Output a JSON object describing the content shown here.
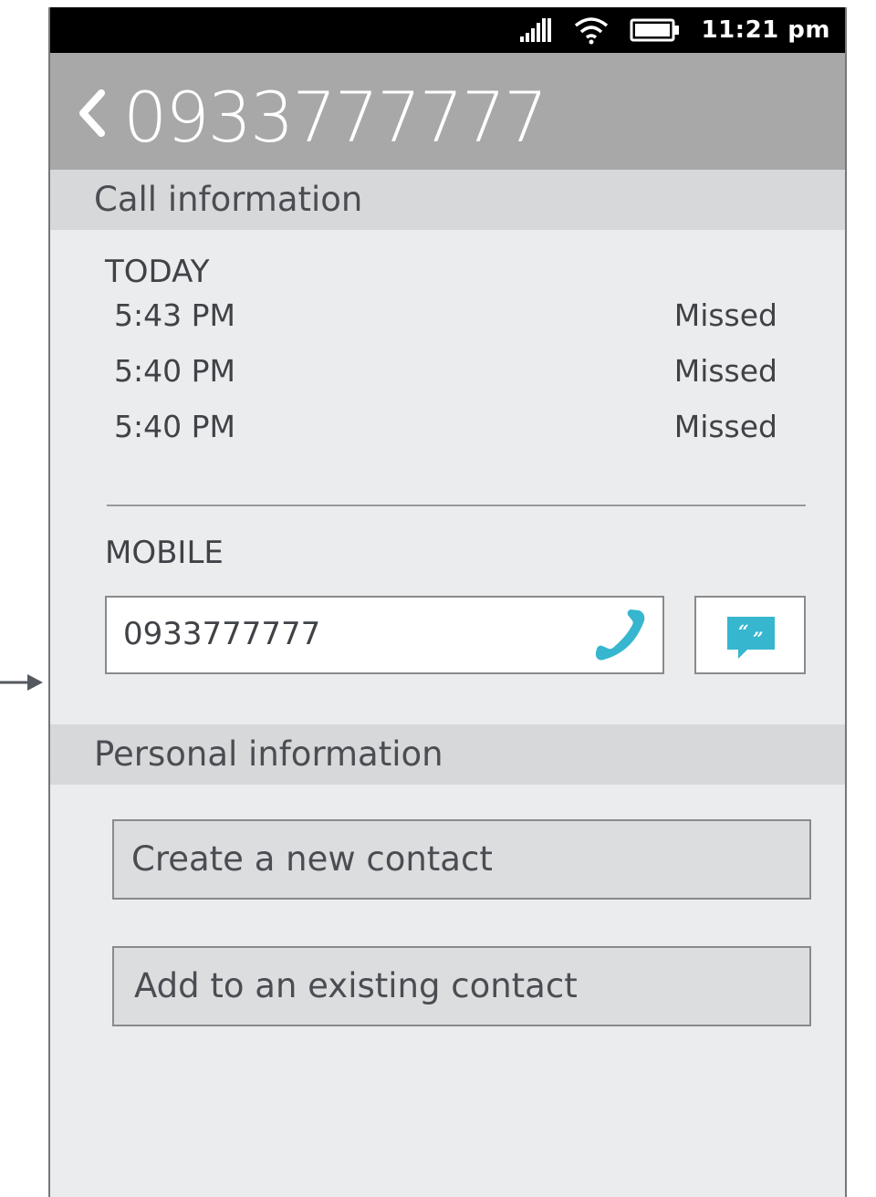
{
  "status_bar": {
    "time": "11:21 pm",
    "icons": [
      "signal-icon",
      "wifi-icon",
      "battery-icon"
    ]
  },
  "header": {
    "title": "0933777777",
    "back_icon": "chevron-left-icon"
  },
  "call_info": {
    "section_title": "Call information",
    "day_label": "TODAY",
    "calls": [
      {
        "time": "5:43 PM",
        "status": "Missed"
      },
      {
        "time": "5:40 PM",
        "status": "Missed"
      },
      {
        "time": "5:40 PM",
        "status": "Missed"
      }
    ]
  },
  "mobile": {
    "label": "MOBILE",
    "number": "0933777777",
    "call_icon": "phone-icon",
    "sms_icon": "message-quote-icon"
  },
  "personal_info": {
    "section_title": "Personal information",
    "create_contact_label": "Create a new contact",
    "add_existing_label": "Add to an existing contact"
  },
  "colors": {
    "accent": "#36b6cf",
    "header_bg": "#a8a8a8",
    "section_bg": "#d7d8da",
    "page_bg": "#ebecee"
  }
}
